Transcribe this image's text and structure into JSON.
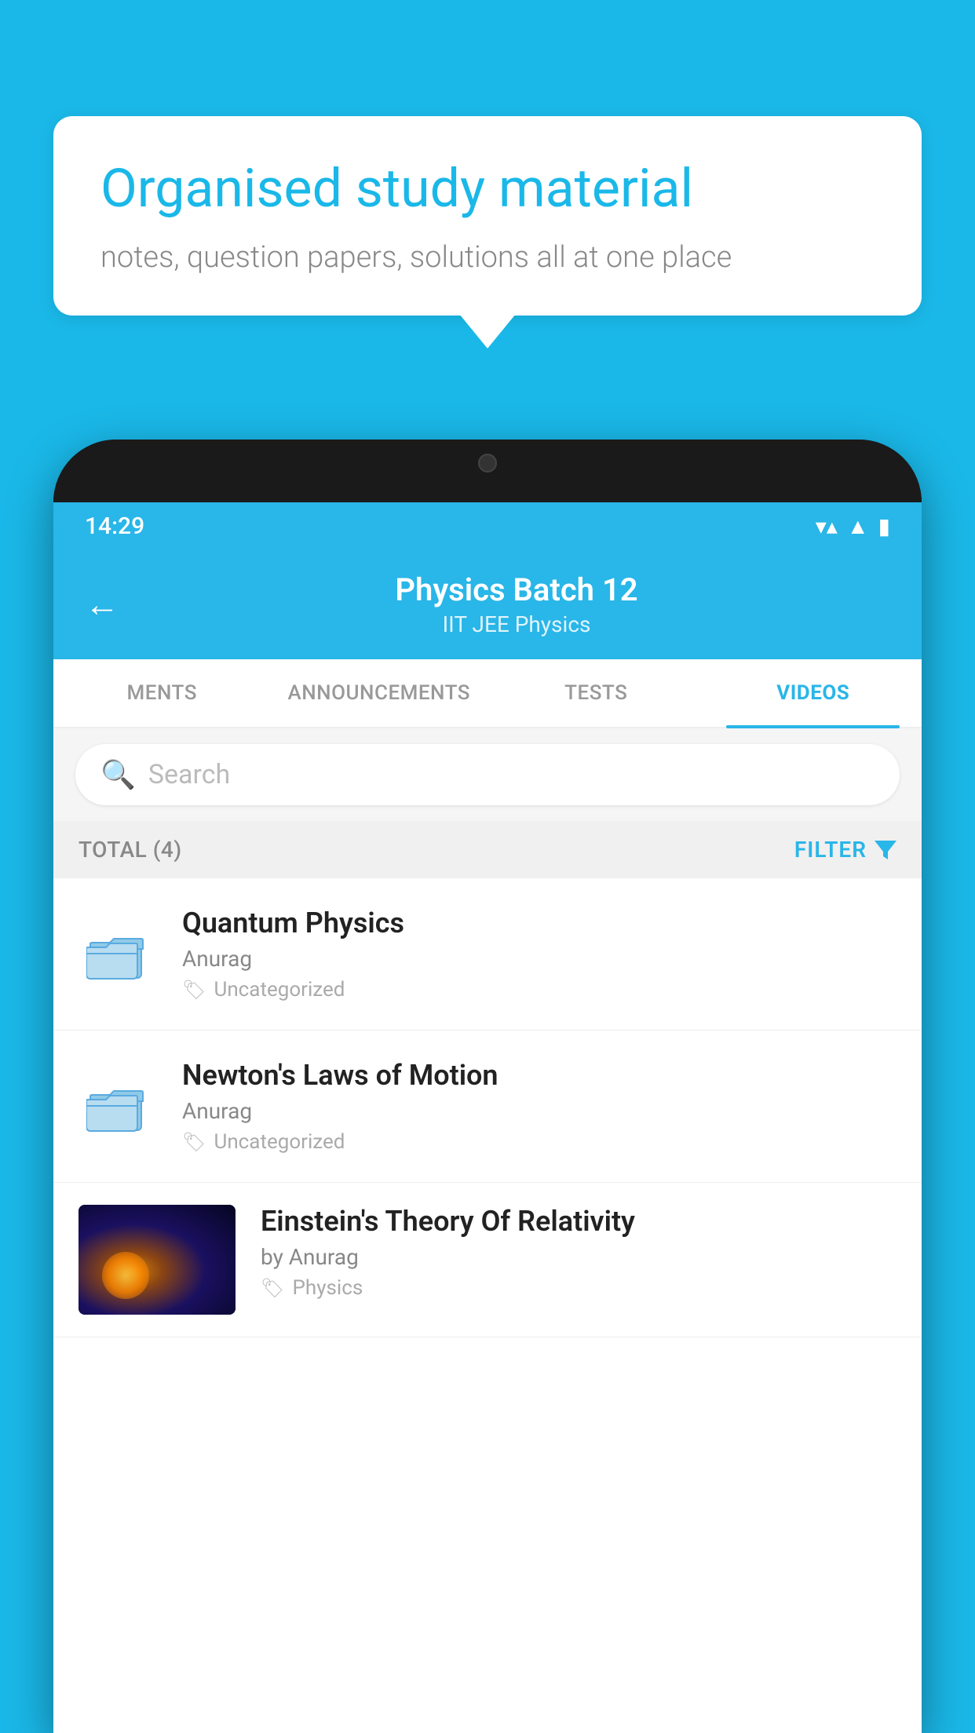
{
  "background_color": "#1ab8e8",
  "speech_bubble": {
    "title": "Organised study material",
    "subtitle": "notes, question papers, solutions all at one place"
  },
  "status_bar": {
    "time": "14:29",
    "wifi_icon": "▼▲",
    "signal_icon": "▲",
    "battery_icon": "▮"
  },
  "header": {
    "back_label": "←",
    "title": "Physics Batch 12",
    "subtitle": "IIT JEE   Physics"
  },
  "tabs": [
    {
      "label": "MENTS",
      "active": false
    },
    {
      "label": "ANNOUNCEMENTS",
      "active": false
    },
    {
      "label": "TESTS",
      "active": false
    },
    {
      "label": "VIDEOS",
      "active": true
    }
  ],
  "search": {
    "placeholder": "Search"
  },
  "filter_bar": {
    "total_label": "TOTAL (4)",
    "filter_label": "FILTER"
  },
  "videos": [
    {
      "title": "Quantum Physics",
      "author": "Anurag",
      "tag": "Uncategorized",
      "type": "folder"
    },
    {
      "title": "Newton's Laws of Motion",
      "author": "Anurag",
      "tag": "Uncategorized",
      "type": "folder"
    },
    {
      "title": "Einstein's Theory Of Relativity",
      "author": "by Anurag",
      "tag": "Physics",
      "type": "video"
    }
  ]
}
